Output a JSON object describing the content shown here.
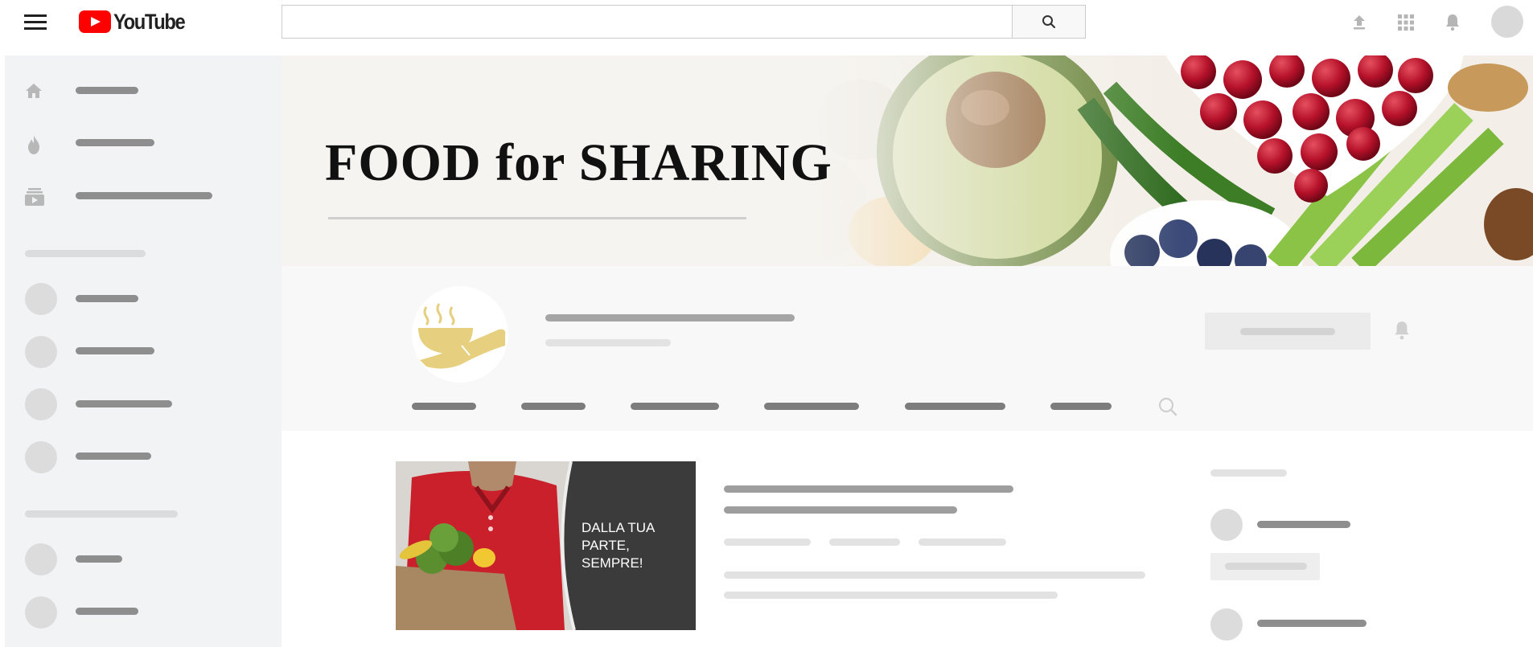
{
  "app": {
    "logo_text": "YouTube"
  },
  "search": {
    "placeholder": ""
  },
  "banner": {
    "title": "FOOD for SHARING"
  },
  "video": {
    "thumbnail_caption": "DALLA TUA PARTE, SEMPRE!"
  },
  "icons": {
    "menu": "hamburger-icon",
    "search": "search-icon",
    "upload": "upload-icon",
    "apps": "apps-grid-icon",
    "notifications": "bell-icon",
    "sidebar_home": "home-icon",
    "sidebar_trending": "flame-icon",
    "sidebar_subscriptions": "subscriptions-icon",
    "channel_search": "search-icon",
    "subscribe_bell": "bell-icon"
  },
  "colors": {
    "brand_red": "#ff0000",
    "logo_gold": "#e6cf7e",
    "sidebar_bg": "#f2f3f5",
    "placeholder_dark": "#8e8e8e",
    "placeholder_light": "#e2e2e2"
  }
}
